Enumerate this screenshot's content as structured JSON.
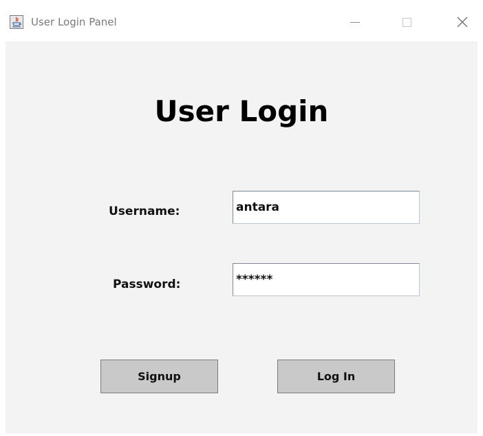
{
  "window": {
    "title": "User Login Panel",
    "app_icon": "java-icon",
    "controls": {
      "minimize_icon": "minimize-icon",
      "maximize_icon": "maximize-icon",
      "close_icon": "close-icon",
      "close_glyph": "✕"
    }
  },
  "form": {
    "heading": "User Login",
    "username_label": "Username:",
    "username_value": "antara",
    "password_label": "Password:",
    "password_value": "******",
    "signup_label": "Signup",
    "login_label": "Log In"
  },
  "colors": {
    "panel_background": "#f3f3f3",
    "button_background": "#c9c9c9",
    "title_text": "#7a7a7a"
  }
}
